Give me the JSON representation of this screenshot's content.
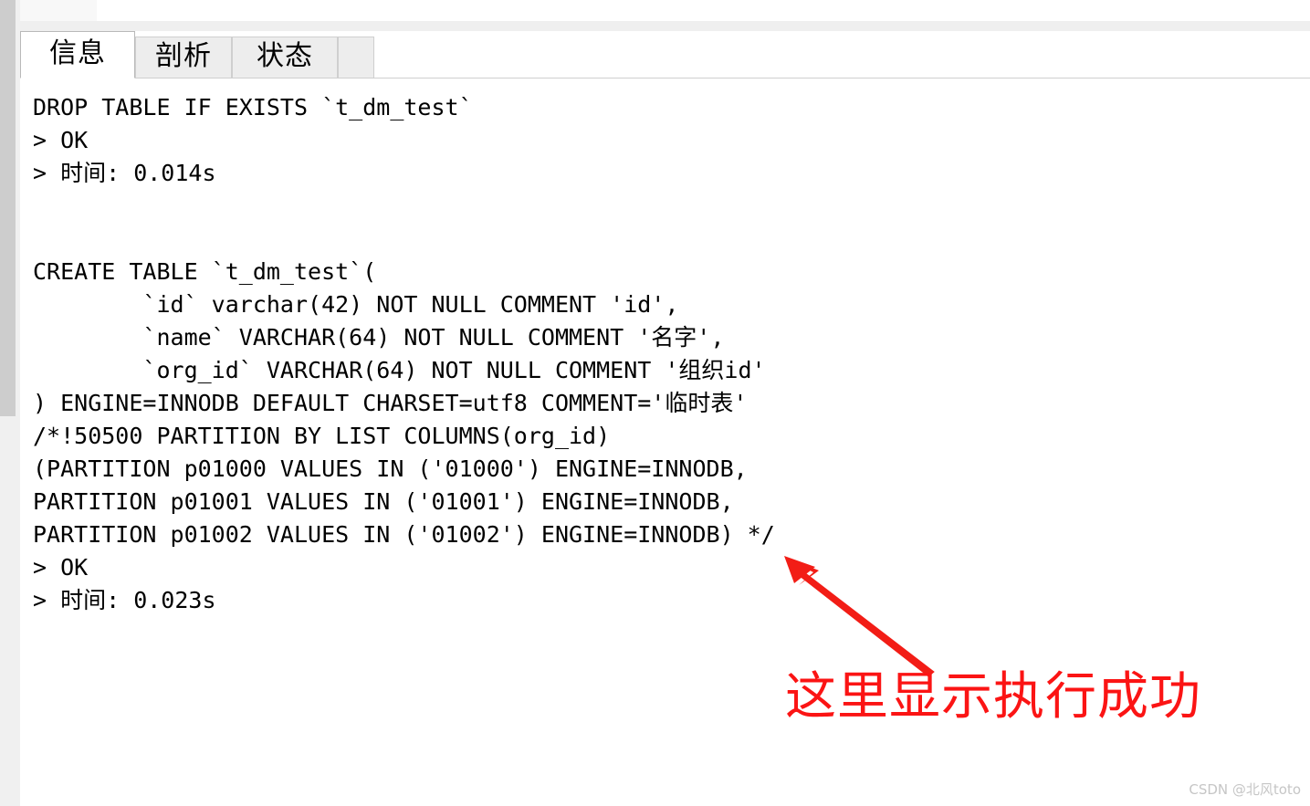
{
  "window": {
    "tab_strip": {
      "stub_label": ""
    }
  },
  "tabs": [
    {
      "label": "信息",
      "name": "tab-information",
      "active": true
    },
    {
      "label": "剖析",
      "name": "tab-profile",
      "active": false
    },
    {
      "label": "状态",
      "name": "tab-status",
      "active": false
    }
  ],
  "log": {
    "lines": [
      "DROP TABLE IF EXISTS `t_dm_test`",
      "> OK",
      "> 时间: 0.014s",
      "",
      "",
      "CREATE TABLE `t_dm_test`(",
      "        `id` varchar(42) NOT NULL COMMENT 'id',",
      "        `name` VARCHAR(64) NOT NULL COMMENT '名字',",
      "        `org_id` VARCHAR(64) NOT NULL COMMENT '组织id'",
      ") ENGINE=INNODB DEFAULT CHARSET=utf8 COMMENT='临时表'",
      "/*!50500 PARTITION BY LIST COLUMNS(org_id)",
      "(PARTITION p01000 VALUES IN ('01000') ENGINE=INNODB,",
      "PARTITION p01001 VALUES IN ('01001') ENGINE=INNODB,",
      "PARTITION p01002 VALUES IN ('01002') ENGINE=INNODB) */",
      "> OK",
      "> 时间: 0.023s"
    ],
    "text": "DROP TABLE IF EXISTS `t_dm_test`\n> OK\n> 时间: 0.014s\n\n\nCREATE TABLE `t_dm_test`(\n        `id` varchar(42) NOT NULL COMMENT 'id',\n        `name` VARCHAR(64) NOT NULL COMMENT '名字',\n        `org_id` VARCHAR(64) NOT NULL COMMENT '组织id'\n) ENGINE=INNODB DEFAULT CHARSET=utf8 COMMENT='临时表'\n/*!50500 PARTITION BY LIST COLUMNS(org_id)\n(PARTITION p01000 VALUES IN ('01000') ENGINE=INNODB,\nPARTITION p01001 VALUES IN ('01001') ENGINE=INNODB,\nPARTITION p01002 VALUES IN ('01002') ENGINE=INNODB) */\n> OK\n> 时间: 0.023s"
  },
  "annotation": {
    "text": "这里显示执行成功",
    "color": "#fb1414",
    "arrow_name": "red-arrow-icon"
  },
  "watermark": {
    "text": "CSDN @北风toto"
  },
  "colors": {
    "accent_red": "#fb1414",
    "tab_active_bg": "#ffffff",
    "tab_inactive_bg": "#ededed",
    "panel_bg": "#ffffff",
    "scrollbar_thumb": "#cdcdcd",
    "scrollbar_track": "#f0f0f0",
    "border": "#cfcfcf"
  }
}
